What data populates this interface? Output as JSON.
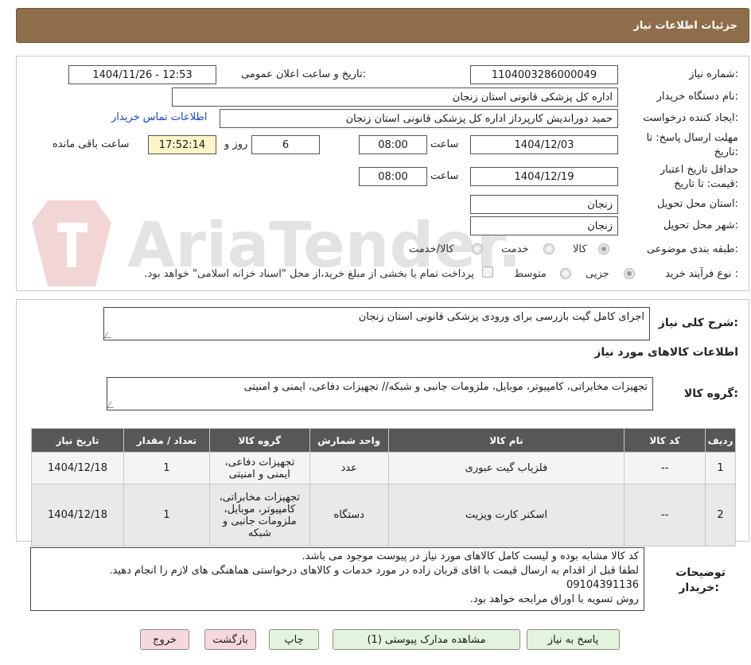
{
  "header": {
    "title": "جزئیات اطلاعات نیاز"
  },
  "form": {
    "need_number_label": "شماره نیاز:",
    "need_number": "1104003286000049",
    "announce_label": "تاریخ و ساعت اعلان عمومی:",
    "announce_value": "1404/11/26 - 12:53",
    "buyer_org_label": "نام دستگاه خریدار:",
    "buyer_org": "اداره کل پزشکی قانونی استان زنجان",
    "creator_label": "ایجاد کننده درخواست:",
    "creator": "حمید دوراندیش کارپرداز اداره کل پزشکی قانونی استان زنجان",
    "contact_link": "اطلاعات تماس خریدار",
    "deadline_label_1": "مهلت ارسال پاسخ: تا",
    "deadline_label_2": "تاریخ:",
    "deadline_date": "1404/12/03",
    "time_label": "ساعت",
    "deadline_time": "08:00",
    "days_value": "6",
    "days_label": "روز و",
    "remaining_time": "17:52:14",
    "remaining_label": "ساعت باقی مانده",
    "validity_label_1": "حداقل تاریخ اعتبار",
    "validity_label_2": "قیمت: تا تاریخ:",
    "validity_date": "1404/12/19",
    "validity_time": "08:00",
    "province_label": "استان محل تحویل:",
    "province": "زنجان",
    "city_label": "شهر محل تحویل:",
    "city": "زنجان",
    "category_label": "طبقه بندی موضوعی:",
    "category_options": [
      "کالا",
      "خدمت",
      "کالا/خدمت"
    ],
    "category_selected": "کالا",
    "purchase_type_label": "نوع فرآیند خرید :",
    "purchase_options": [
      "جزیی",
      "متوسط"
    ],
    "purchase_note": "پرداخت تمام یا بخشی از مبلغ خرید،از محل \"اسناد خزانه اسلامی\" خواهد بود."
  },
  "description": {
    "label": "شرح کلی نیاز:",
    "value": "اجرای کامل گیت بازرسی برای ورودی پزشکی قانونی استان زنجان"
  },
  "goods_info": {
    "title": "اطلاعات کالاهای مورد نیاز",
    "group_label": "گروه کالا:",
    "group_value": "تجهیزات مخابراتی، کامپیوتر، موبایل، ملزومات جانبی و شبکه// تجهیزات دفاعی، ایمنی و امنیتی"
  },
  "table": {
    "headers": [
      "ردیف",
      "کد کالا",
      "نام کالا",
      "واحد شمارش",
      "گروه کالا",
      "تعداد / مقدار",
      "تاریخ نیاز"
    ],
    "rows": [
      {
        "row": "1",
        "code": "--",
        "name": "فلزیاب گیت عبوری",
        "unit": "عدد",
        "group": "تجهیزات دفاعی، ایمنی و امنیتی",
        "qty": "1",
        "date": "1404/12/18"
      },
      {
        "row": "2",
        "code": "--",
        "name": "اسکنر کارت ویزیت",
        "unit": "دستگاه",
        "group": "تجهیزات مخابراتی، کامپیوتر، موبایل، ملزومات جانبی و شبکه",
        "qty": "1",
        "date": "1404/12/18"
      }
    ]
  },
  "buyer_notes": {
    "label_1": "توضیحات",
    "label_2": "خریدار:",
    "lines": [
      "کد کالا مشابه بوده و لیست کامل کالاهای مورد نیاز در پیوست موجود می باشد.",
      "لطفا قبل از اقدام به ارسال قیمت با اقای قربان زاده در مورد خدمات و کالاهای درخواستی هماهنگی های لازم را انجام دهید.",
      "09104391136",
      "روش تسویه با اوراق مرابحه خواهد بود."
    ]
  },
  "buttons": {
    "respond": "پاسخ به نیاز",
    "attachments": "مشاهده مدارک پیوستی (1)",
    "print": "چاپ",
    "back": "بازگشت",
    "exit": "خروج"
  },
  "watermark": {
    "text": "AriaTender.neT"
  },
  "colors": {
    "header_bg": "#8e6e4a",
    "table_header_bg": "#575757",
    "button_green": "#e4f4dc",
    "button_red": "#f6d9dc",
    "time_bg": "#fdf5c8",
    "link": "#1346c8"
  }
}
